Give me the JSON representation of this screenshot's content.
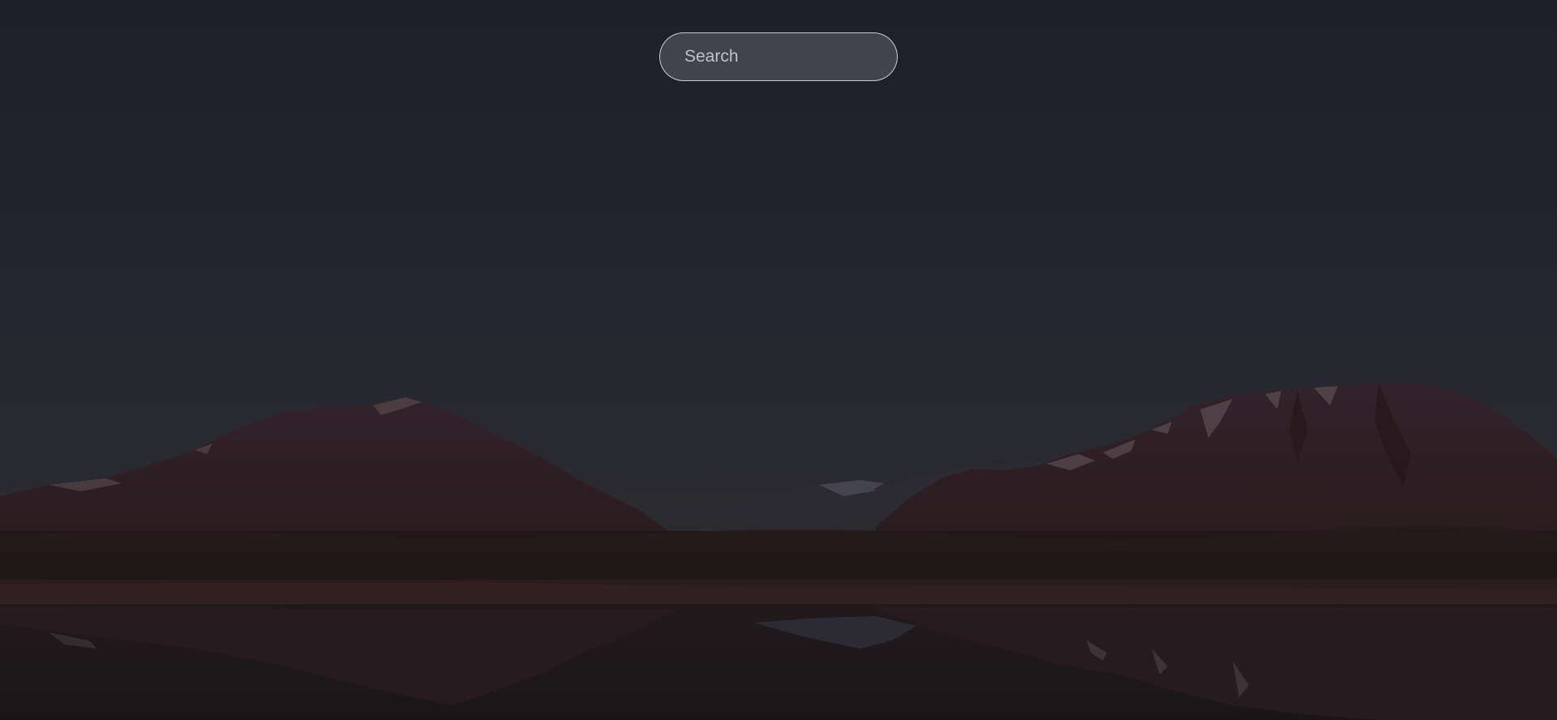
{
  "search": {
    "placeholder": "Search",
    "value": ""
  },
  "wallpaper": {
    "scene": "mountain-lake-at-dusk",
    "sky_color": "#1f222b",
    "mountain_color": "#2e2022",
    "water_color": "#1c1719"
  }
}
